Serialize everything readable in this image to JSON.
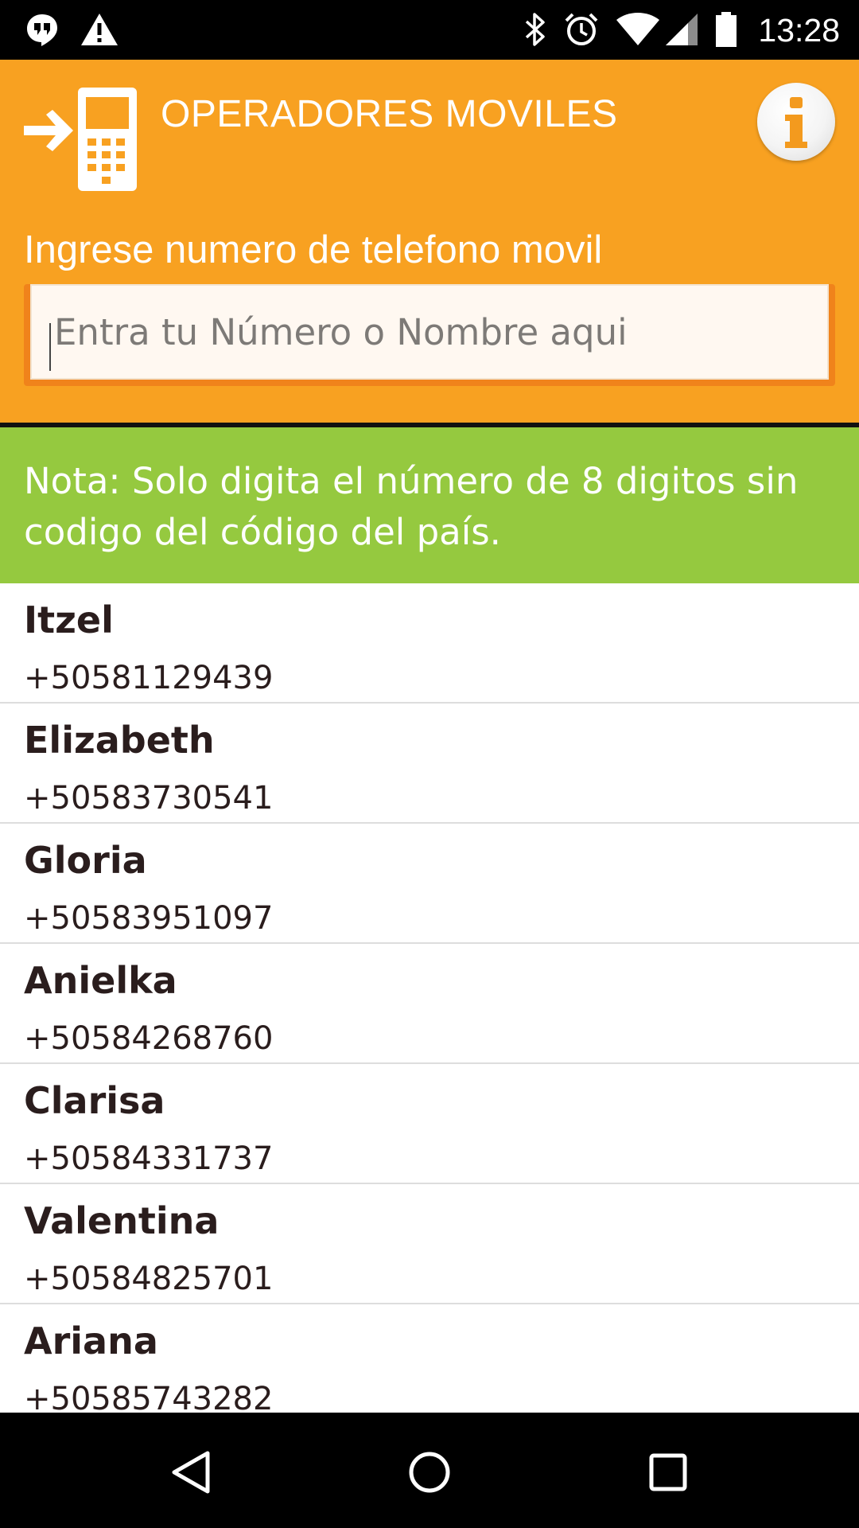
{
  "status_bar": {
    "time": "13:28",
    "left_icons": [
      "hangouts-icon",
      "warning-icon"
    ],
    "right_icons": [
      "bluetooth-icon",
      "alarm-icon",
      "wifi-icon",
      "cell-signal-icon",
      "battery-icon"
    ]
  },
  "header": {
    "title": "OPERADORES MOVILES",
    "logo_icon": "phone-arrow-icon",
    "info_icon": "info-icon",
    "prompt_label": "Ingrese numero de telefono movil",
    "search_placeholder": "Entra tu Número o Nombre aqui",
    "search_value": ""
  },
  "note": {
    "text": "Nota: Solo digita el número de 8 digitos sin codigo del código del país."
  },
  "contacts": [
    {
      "name": "Itzel",
      "phone": "+50581129439"
    },
    {
      "name": "Elizabeth",
      "phone": "+50583730541"
    },
    {
      "name": "Gloria",
      "phone": "+50583951097"
    },
    {
      "name": "Anielka",
      "phone": "+50584268760"
    },
    {
      "name": "Clarisa",
      "phone": "+50584331737"
    },
    {
      "name": "Valentina",
      "phone": "+50584825701"
    },
    {
      "name": "Ariana",
      "phone": "+50585743282"
    }
  ],
  "nav_bar": {
    "buttons": [
      "back-icon",
      "home-icon",
      "recents-icon"
    ]
  },
  "colors": {
    "header": "#f8a121",
    "note": "#95c93f",
    "input_border": "#f0831b",
    "text_dark": "#2a1d1d"
  }
}
